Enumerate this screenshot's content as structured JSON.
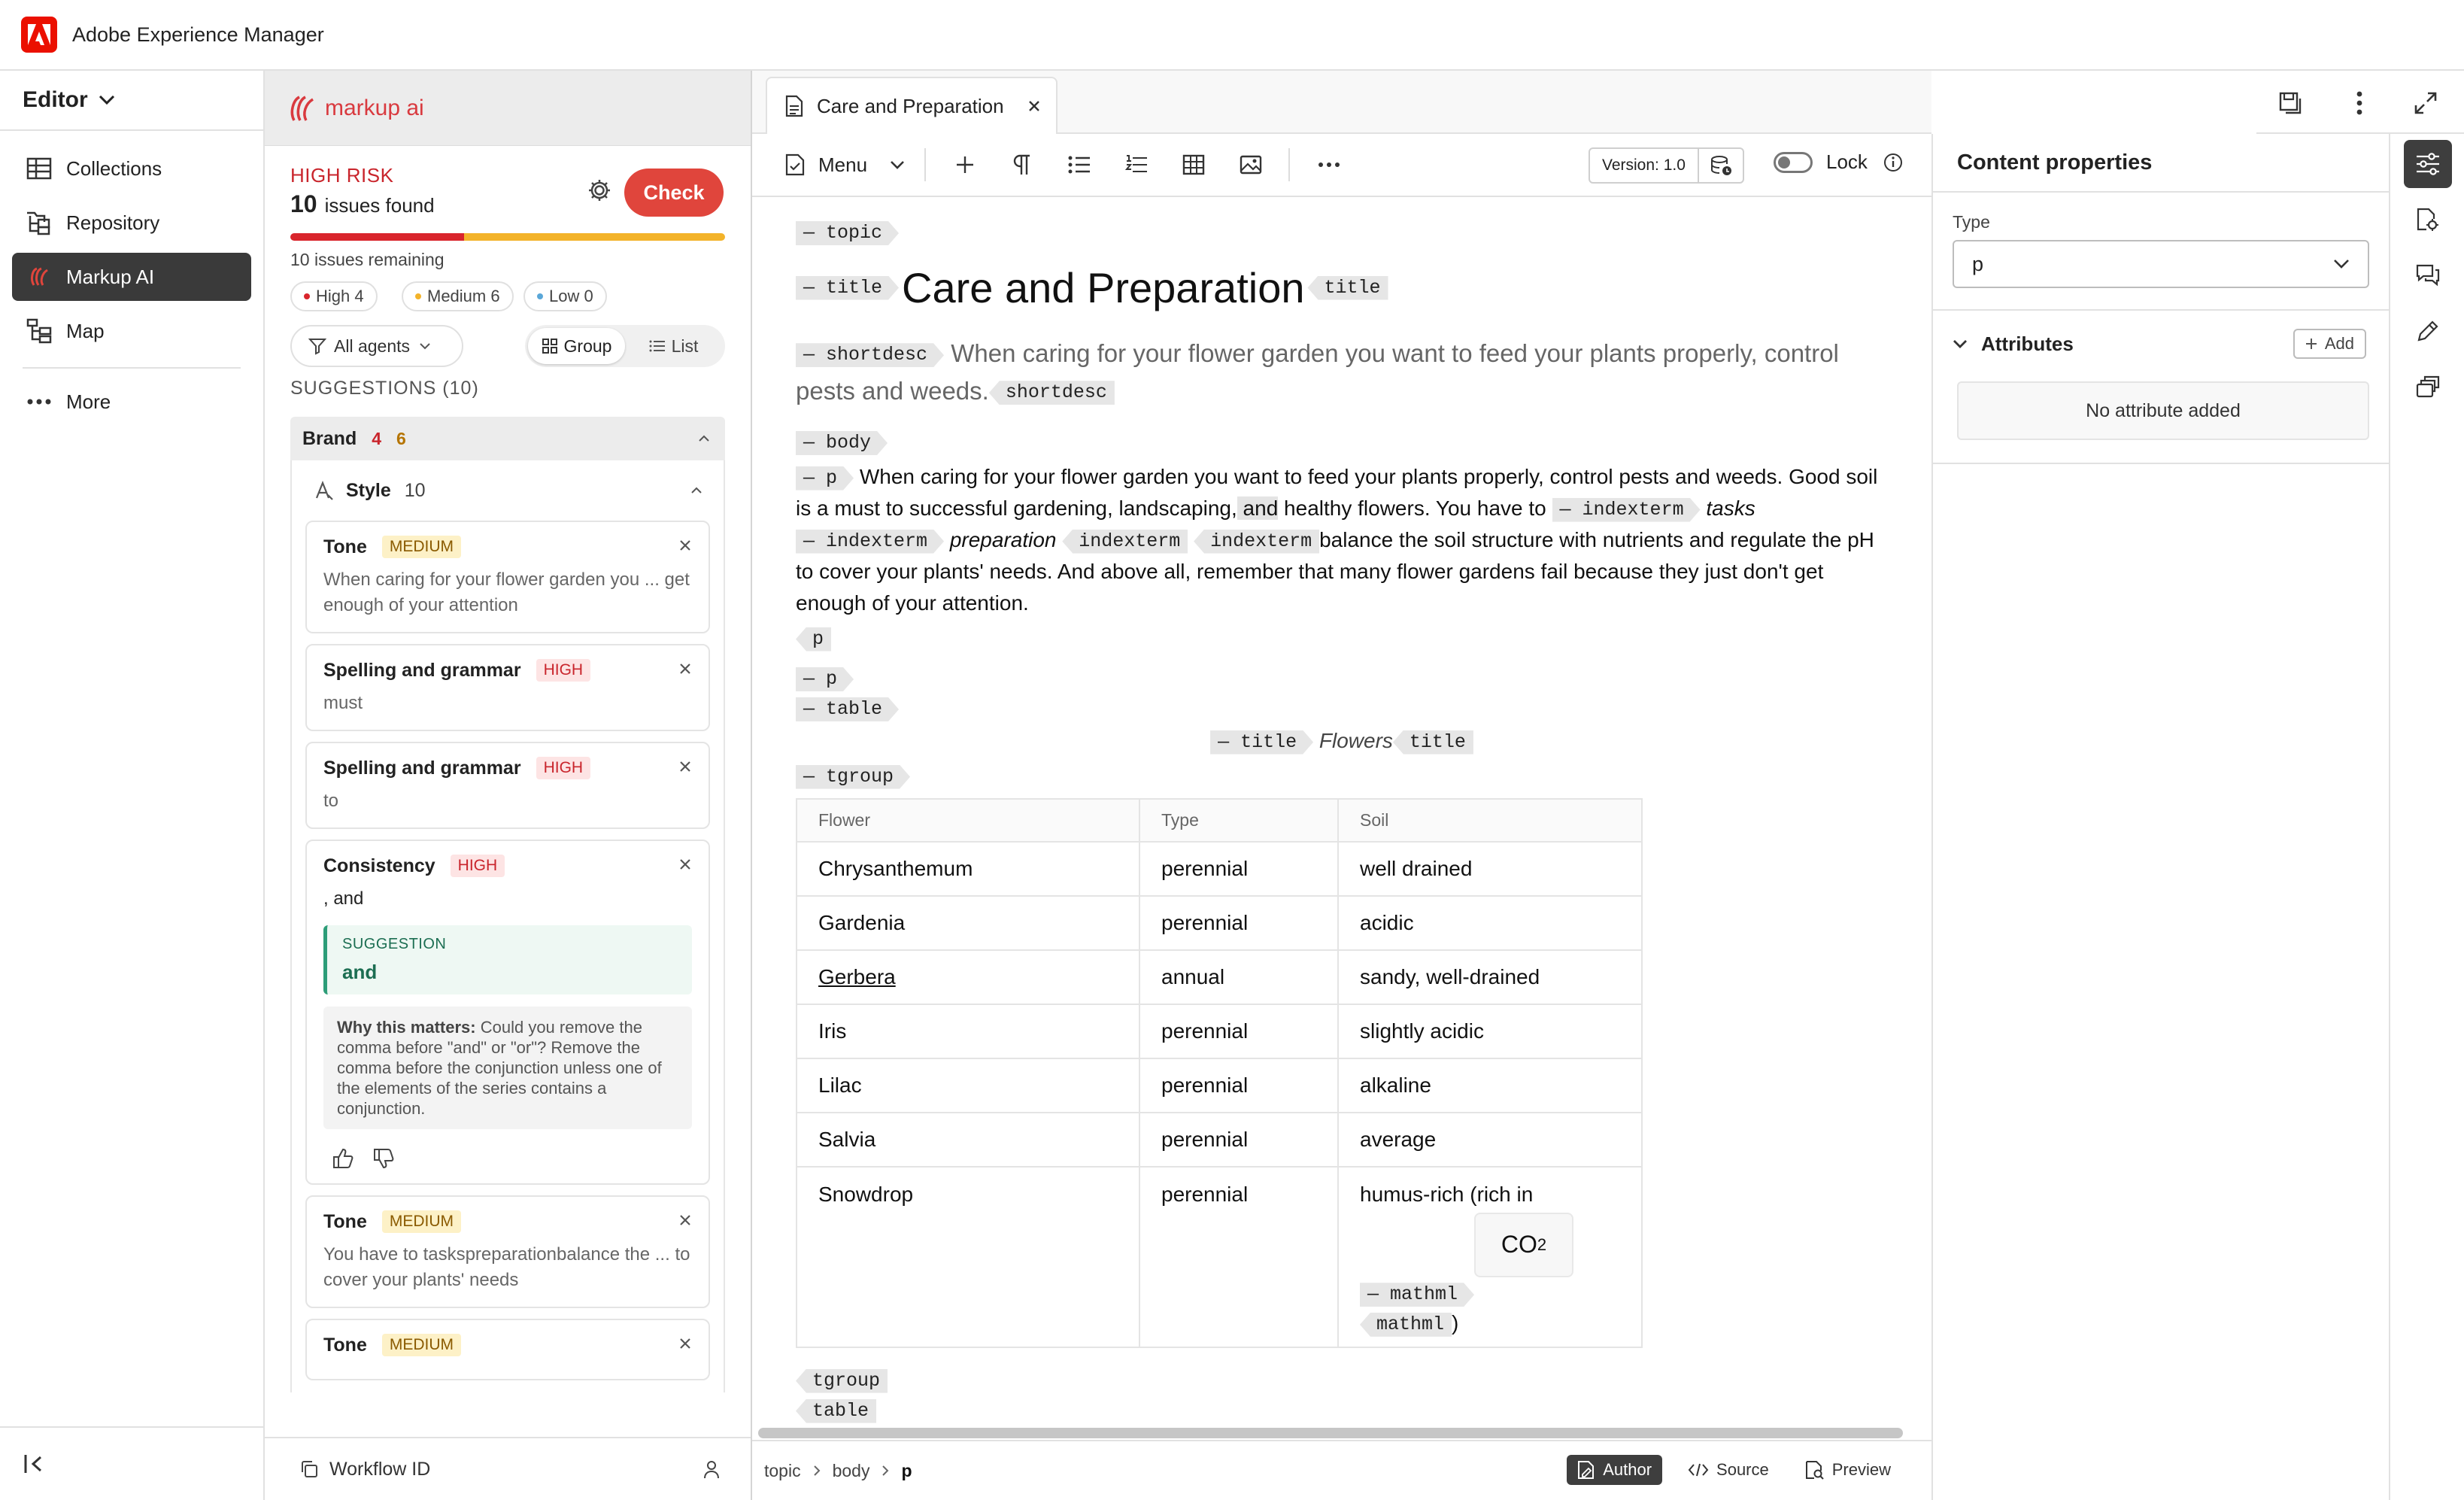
{
  "app": {
    "title": "Adobe Experience Manager"
  },
  "nav": {
    "editor_label": "Editor",
    "items": [
      {
        "label": "Collections",
        "icon": "grid-icon"
      },
      {
        "label": "Repository",
        "icon": "folder-tree-icon"
      },
      {
        "label": "Markup AI",
        "icon": "markup-ai-icon"
      },
      {
        "label": "Map",
        "icon": "map-tree-icon"
      }
    ],
    "active_item": "Markup AI",
    "more_label": "More"
  },
  "markup": {
    "brand": "markup ai",
    "risk_label": "HIGH RISK",
    "issues_count": "10",
    "issues_text": "issues found",
    "check_label": "Check",
    "remaining": "10 issues remaining",
    "chips": {
      "high": "High 4",
      "medium": "Medium 6",
      "low": "Low 0"
    },
    "agents_label": "All agents",
    "group_label": "Group",
    "list_label": "List",
    "suggestions_title": "SUGGESTIONS (10)",
    "brand_group": {
      "label": "Brand",
      "high": "4",
      "medium": "6"
    },
    "style_group": {
      "label": "Style",
      "count": "10"
    },
    "cards": [
      {
        "title": "Tone",
        "severity": "MEDIUM",
        "text": "When caring for your flower garden you ... get enough of your attention"
      },
      {
        "title": "Spelling and grammar",
        "severity": "HIGH",
        "text": "must"
      },
      {
        "title": "Spelling and grammar",
        "severity": "HIGH",
        "text": "to"
      },
      {
        "title": "Consistency",
        "severity": "HIGH",
        "text": ", and",
        "suggestion_label": "SUGGESTION",
        "suggestion": "and",
        "why_label": "Why this matters:",
        "why_text": "Could you remove the comma before \"and\" or \"or\"? Remove the comma before the conjunction unless one of the elements of the series contains a conjunction."
      },
      {
        "title": "Tone",
        "severity": "MEDIUM",
        "text": "You have to taskspreparationbalance the ... to cover your plants' needs"
      },
      {
        "title": "Tone",
        "severity": "MEDIUM",
        "text": ""
      }
    ],
    "workflow_label": "Workflow ID"
  },
  "editor": {
    "tab_title": "Care and Preparation",
    "menu_label": "Menu",
    "version_label": "Version: 1.0",
    "lock_label": "Lock",
    "tags": {
      "topic": "topic",
      "title": "title",
      "shortdesc": "shortdesc",
      "body": "body",
      "p": "p",
      "indexterm": "indexterm",
      "table": "table",
      "tgroup": "tgroup",
      "mathml": "mathml"
    },
    "doc_title": "Care and Preparation",
    "shortdesc": "When caring for your flower garden you want to feed your plants properly, control pests and weeds.",
    "para": {
      "part1": "When caring for your flower garden you want to feed your plants properly, control pests and weeds. Good soil is a must to successful gardening, landscaping,",
      "and_word": " and",
      "part2": " healthy flowers. You have to",
      "tasks": "tasks",
      "preparation": "preparation",
      "part3": "balance the soil structure with nutrients and regulate the pH to cover your plants' needs. And above all, remember that many flower gardens fail because they just don't get enough of your attention."
    },
    "table_title": "Flowers",
    "table_headers": [
      "Flower",
      "Type",
      "Soil"
    ],
    "table_rows": [
      [
        "Chrysanthemum",
        "perennial",
        "well drained"
      ],
      [
        "Gardenia",
        "perennial",
        "acidic"
      ],
      [
        "Gerbera",
        "annual",
        "sandy, well-drained"
      ],
      [
        "Iris",
        "perennial",
        "slightly acidic"
      ],
      [
        "Lilac",
        "perennial",
        "alkaline"
      ],
      [
        "Salvia",
        "perennial",
        "average"
      ],
      [
        "Snowdrop",
        "perennial",
        "humus-rich (rich in"
      ]
    ],
    "math": {
      "base": "CO",
      "sub": "2"
    },
    "closing_paren": ")",
    "breadcrumb": [
      "topic",
      "body",
      "p"
    ],
    "modes": {
      "author": "Author",
      "source": "Source",
      "preview": "Preview"
    }
  },
  "props": {
    "title": "Content properties",
    "type_label": "Type",
    "type_value": "p",
    "attributes_label": "Attributes",
    "add_label": "Add",
    "no_attr": "No attribute added"
  },
  "colors": {
    "accent_red": "#e0453c",
    "adobe_red": "#eb1000",
    "suggestion_green": "#2d9d78"
  }
}
